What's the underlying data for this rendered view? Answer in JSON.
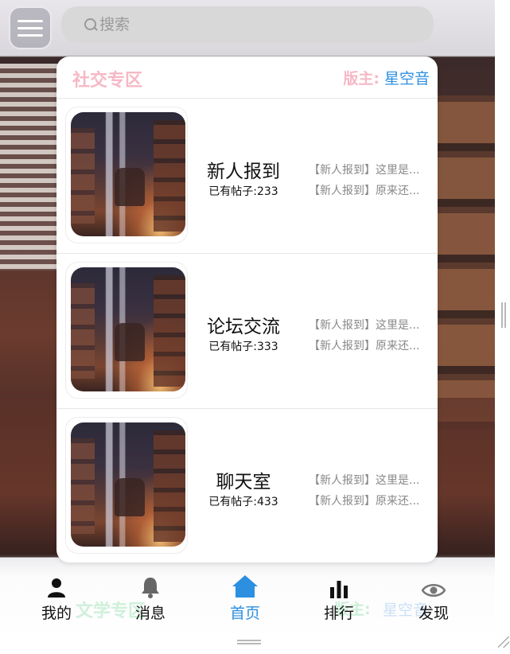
{
  "search": {
    "placeholder": "搜索"
  },
  "panel": {
    "title": "社交专区",
    "moderator_label": "版主:",
    "moderator_name": "星空音",
    "boards": [
      {
        "name": "新人报到",
        "count": "已有帖子:233",
        "posts": [
          "【新人报到】这里是...",
          "【新人报到】原来还..."
        ]
      },
      {
        "name": "论坛交流",
        "count": "已有帖子:333",
        "posts": [
          "【新人报到】这里是...",
          "【新人报到】原来还..."
        ]
      },
      {
        "name": "聊天室",
        "count": "已有帖子:433",
        "posts": [
          "【新人报到】这里是...",
          "【新人报到】原来还..."
        ]
      }
    ]
  },
  "behind": {
    "title": "文学专区",
    "moderator_label": "版主:",
    "moderator_name": "星空音"
  },
  "tabbar": {
    "active_color": "#2c8fe0",
    "tabs": [
      {
        "label": "我的",
        "icon": "user-icon"
      },
      {
        "label": "消息",
        "icon": "bell-icon"
      },
      {
        "label": "首页",
        "icon": "home-icon"
      },
      {
        "label": "排行",
        "icon": "bar-chart-icon"
      },
      {
        "label": "发现",
        "icon": "eye-icon"
      }
    ]
  }
}
